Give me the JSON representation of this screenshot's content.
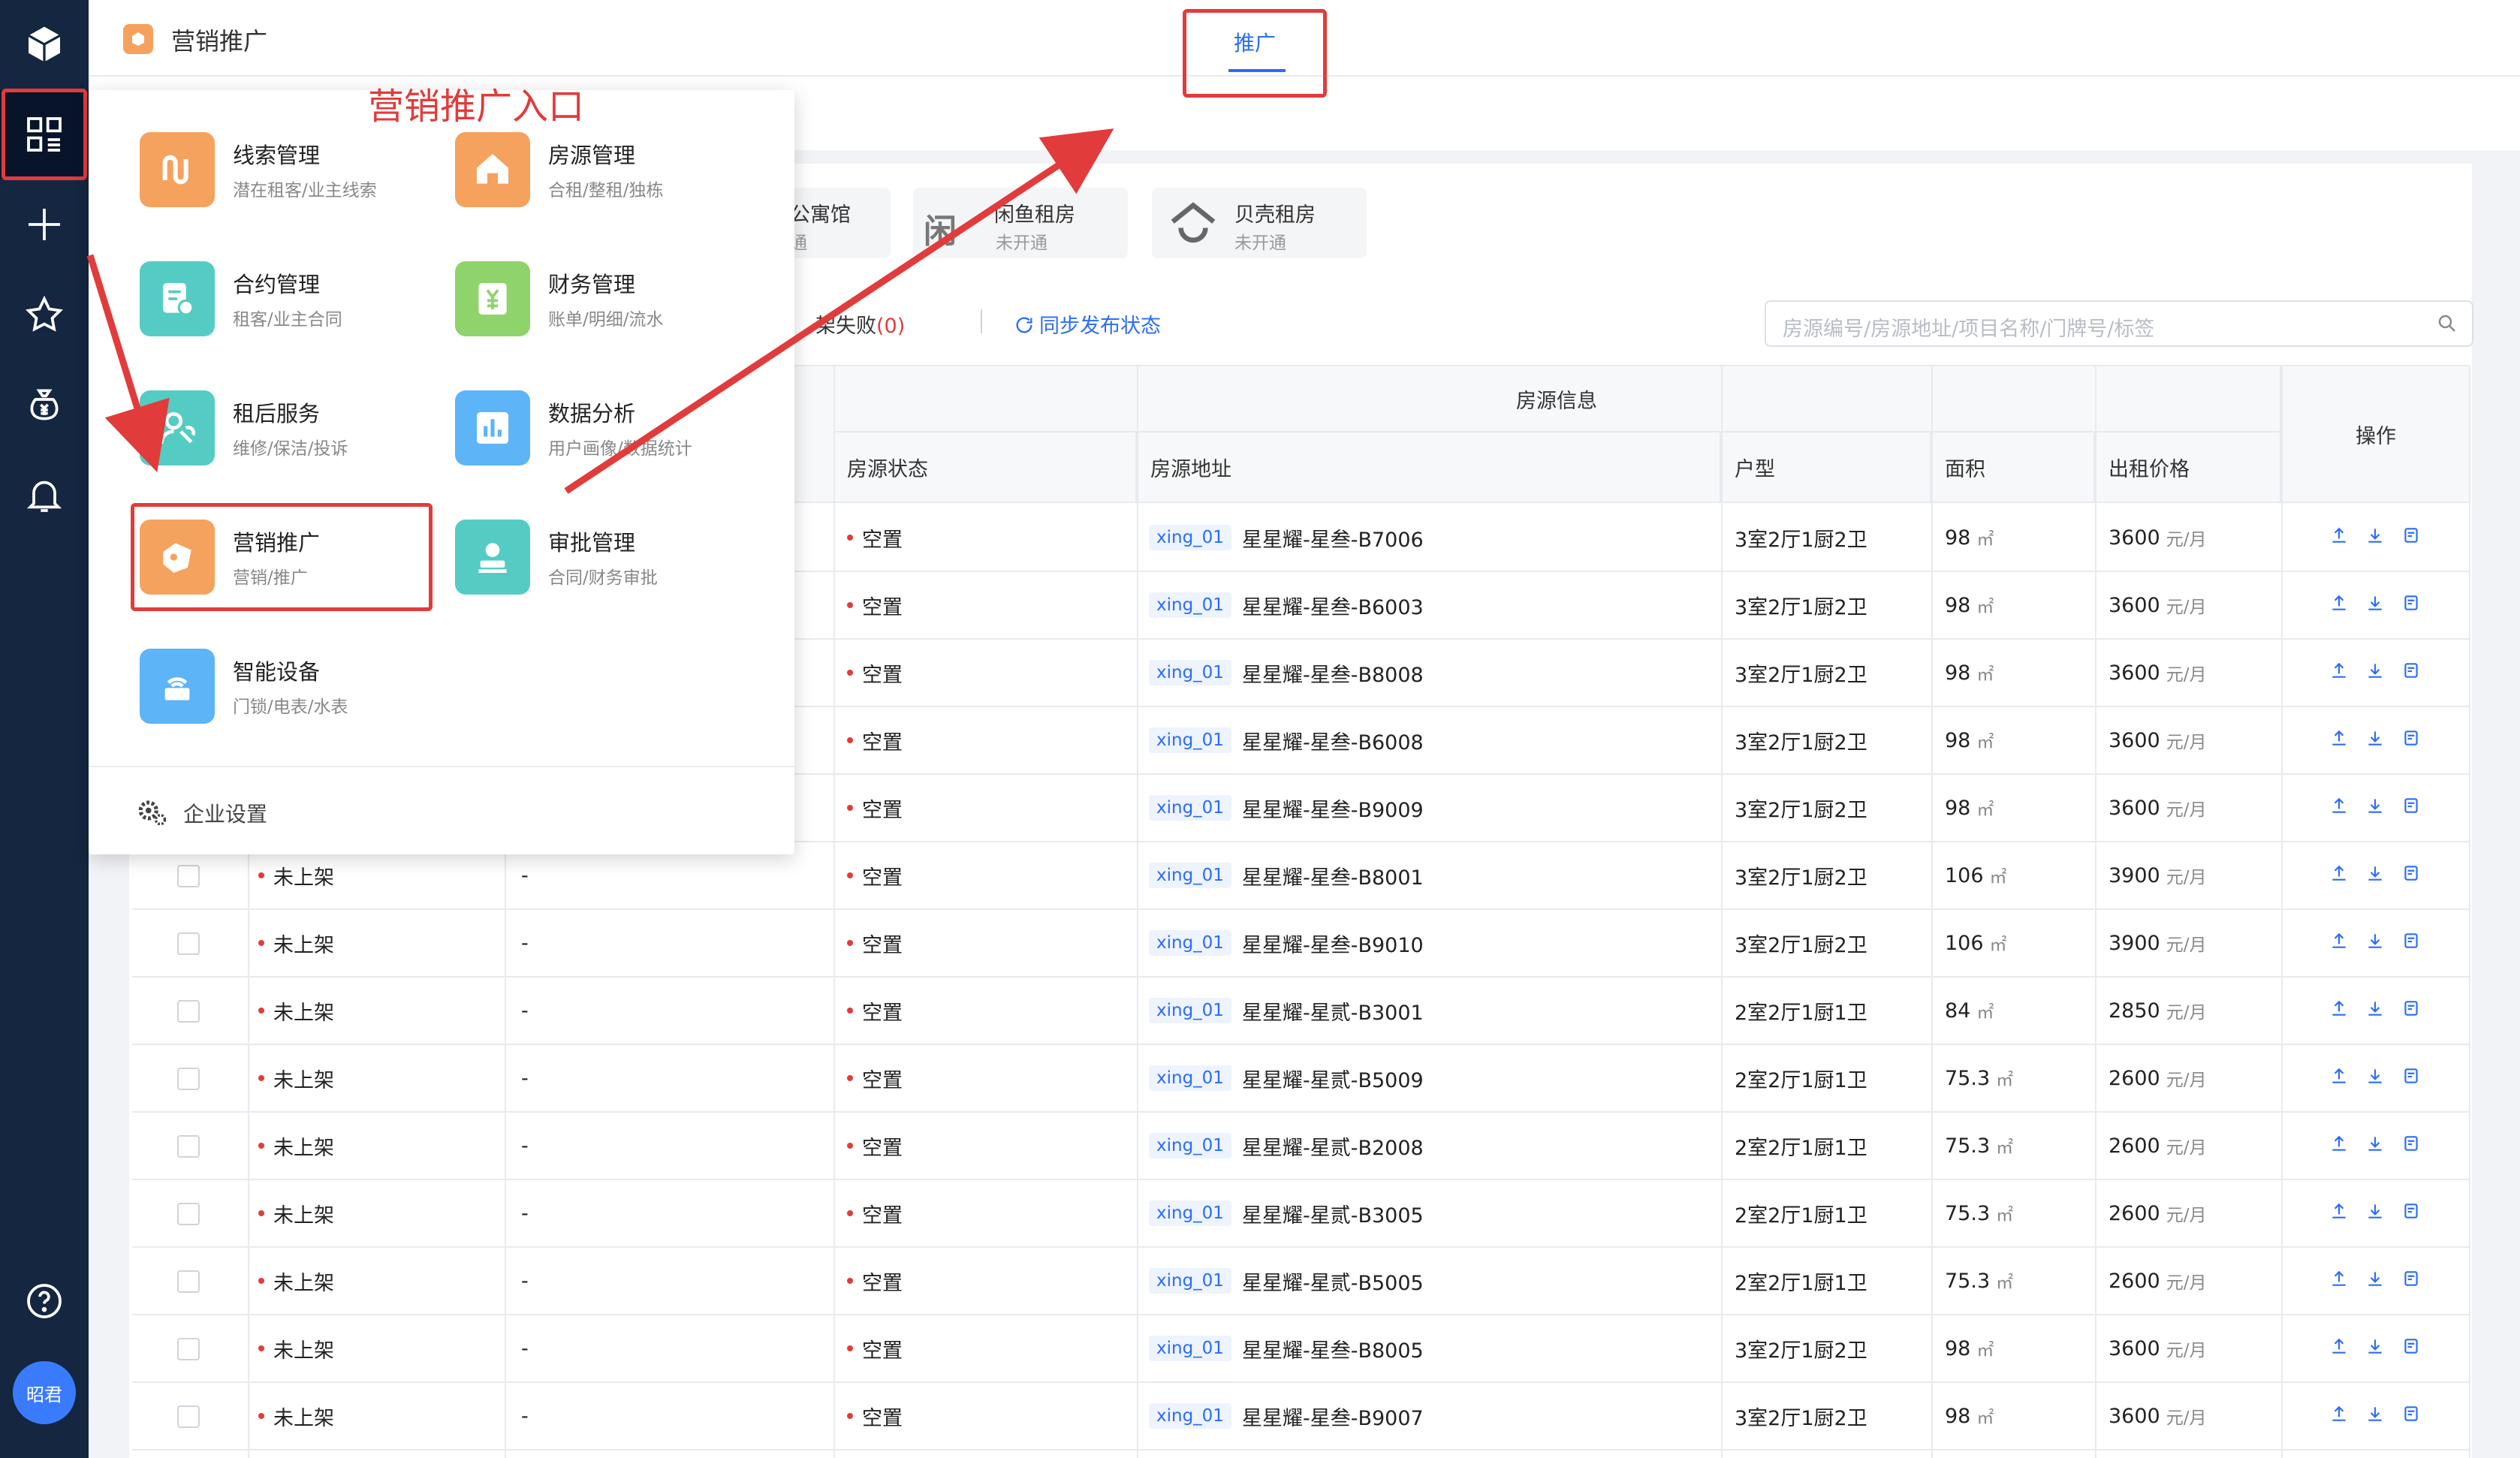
{
  "app": {
    "title": "营销推广"
  },
  "user": {
    "avatar_label": "昭君"
  },
  "tabs": {
    "promo": "推广"
  },
  "annotation": {
    "text": "营销推广入口"
  },
  "menu": {
    "items": [
      {
        "title": "线索管理",
        "sub": "潜在租客/业主线索",
        "icon": "leads-icon",
        "color": "#f5a25e"
      },
      {
        "title": "房源管理",
        "sub": "合租/整租/独栋",
        "icon": "house-icon",
        "color": "#f5a25e"
      },
      {
        "title": "合约管理",
        "sub": "租客/业主合同",
        "icon": "contract-icon",
        "color": "#55ccc3"
      },
      {
        "title": "财务管理",
        "sub": "账单/明细/流水",
        "icon": "finance-icon",
        "color": "#8fd36b"
      },
      {
        "title": "租后服务",
        "sub": "维修/保洁/投诉",
        "icon": "service-icon",
        "color": "#55ccc3"
      },
      {
        "title": "数据分析",
        "sub": "用户画像/数据统计",
        "icon": "chart-icon",
        "color": "#5db4f6"
      },
      {
        "title": "营销推广",
        "sub": "营销/推广",
        "icon": "promo-icon",
        "color": "#f5a25e"
      },
      {
        "title": "审批管理",
        "sub": "合同/财务审批",
        "icon": "approval-icon",
        "color": "#55ccc3"
      },
      {
        "title": "智能设备",
        "sub": "门锁/电表/水表",
        "icon": "device-icon",
        "color": "#5db4f6"
      }
    ],
    "settings": "企业设置"
  },
  "platforms": [
    {
      "name": "公寓馆",
      "status": "通"
    },
    {
      "name": "闲鱼租房",
      "status": "未开通"
    },
    {
      "name": "贝壳租房",
      "status": "未开通"
    }
  ],
  "filters": {
    "failed_label": "架失败",
    "failed_count": "(0)",
    "sync_label": "同步发布状态"
  },
  "search": {
    "placeholder": "房源编号/房源地址/项目名称/门牌号/标签"
  },
  "table": {
    "group_header": "房源信息",
    "ops_header": "操作",
    "columns": [
      "房源状态",
      "房源地址",
      "户型",
      "面积",
      "出租价格"
    ],
    "area_unit": "㎡",
    "price_unit": "元/月",
    "rows": [
      {
        "publish": "",
        "dash": "",
        "status": "空置",
        "tag": "xing_01",
        "address": "星星耀-星叁-B7006",
        "layout": "3室2厅1厨2卫",
        "area": "98",
        "price": "3600"
      },
      {
        "publish": "",
        "dash": "",
        "status": "空置",
        "tag": "xing_01",
        "address": "星星耀-星叁-B6003",
        "layout": "3室2厅1厨2卫",
        "area": "98",
        "price": "3600"
      },
      {
        "publish": "",
        "dash": "",
        "status": "空置",
        "tag": "xing_01",
        "address": "星星耀-星叁-B8008",
        "layout": "3室2厅1厨2卫",
        "area": "98",
        "price": "3600"
      },
      {
        "publish": "",
        "dash": "",
        "status": "空置",
        "tag": "xing_01",
        "address": "星星耀-星叁-B6008",
        "layout": "3室2厅1厨2卫",
        "area": "98",
        "price": "3600"
      },
      {
        "publish": "",
        "dash": "",
        "status": "空置",
        "tag": "xing_01",
        "address": "星星耀-星叁-B9009",
        "layout": "3室2厅1厨2卫",
        "area": "98",
        "price": "3600"
      },
      {
        "publish": "未上架",
        "dash": "-",
        "status": "空置",
        "tag": "xing_01",
        "address": "星星耀-星叁-B8001",
        "layout": "3室2厅1厨2卫",
        "area": "106",
        "price": "3900"
      },
      {
        "publish": "未上架",
        "dash": "-",
        "status": "空置",
        "tag": "xing_01",
        "address": "星星耀-星叁-B9010",
        "layout": "3室2厅1厨2卫",
        "area": "106",
        "price": "3900"
      },
      {
        "publish": "未上架",
        "dash": "-",
        "status": "空置",
        "tag": "xing_01",
        "address": "星星耀-星贰-B3001",
        "layout": "2室2厅1厨1卫",
        "area": "84",
        "price": "2850"
      },
      {
        "publish": "未上架",
        "dash": "-",
        "status": "空置",
        "tag": "xing_01",
        "address": "星星耀-星贰-B5009",
        "layout": "2室2厅1厨1卫",
        "area": "75.3",
        "price": "2600"
      },
      {
        "publish": "未上架",
        "dash": "-",
        "status": "空置",
        "tag": "xing_01",
        "address": "星星耀-星贰-B2008",
        "layout": "2室2厅1厨1卫",
        "area": "75.3",
        "price": "2600"
      },
      {
        "publish": "未上架",
        "dash": "-",
        "status": "空置",
        "tag": "xing_01",
        "address": "星星耀-星贰-B3005",
        "layout": "2室2厅1厨1卫",
        "area": "75.3",
        "price": "2600"
      },
      {
        "publish": "未上架",
        "dash": "-",
        "status": "空置",
        "tag": "xing_01",
        "address": "星星耀-星贰-B5005",
        "layout": "2室2厅1厨1卫",
        "area": "75.3",
        "price": "2600"
      },
      {
        "publish": "未上架",
        "dash": "-",
        "status": "空置",
        "tag": "xing_01",
        "address": "星星耀-星叁-B8005",
        "layout": "3室2厅1厨2卫",
        "area": "98",
        "price": "3600"
      },
      {
        "publish": "未上架",
        "dash": "-",
        "status": "空置",
        "tag": "xing_01",
        "address": "星星耀-星叁-B9007",
        "layout": "3室2厅1厨2卫",
        "area": "98",
        "price": "3600"
      }
    ]
  },
  "colors": {
    "accent": "#2b6cf6",
    "highlight": "#e23b3b",
    "sidebar": "#142640"
  }
}
